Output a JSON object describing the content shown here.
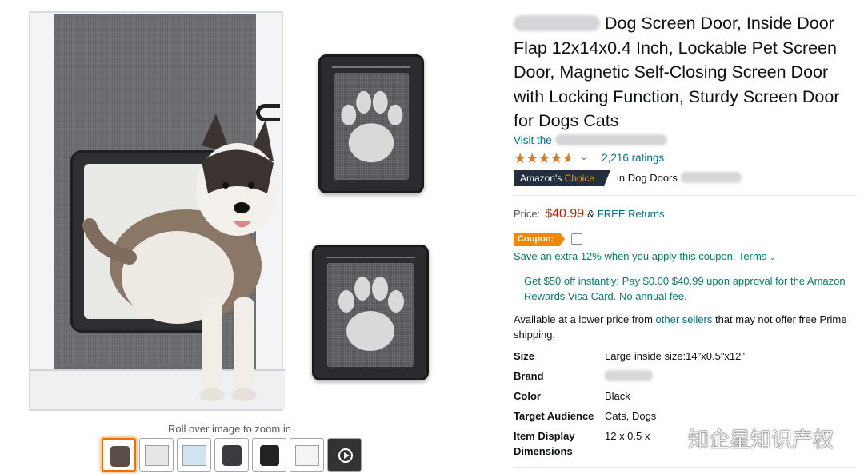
{
  "gallery": {
    "zoom_caption": "Roll over image to zoom in",
    "thumbnails": [
      {
        "kind": "main-dog",
        "active": true
      },
      {
        "kind": "door-dimensions"
      },
      {
        "kind": "installation"
      },
      {
        "kind": "door-detail"
      },
      {
        "kind": "door-dark"
      },
      {
        "kind": "instructions"
      },
      {
        "kind": "video"
      }
    ]
  },
  "product": {
    "title": "Dog Screen Door, Inside Door Flap 12x14x0.4 Inch, Lockable Pet Screen Door, Magnetic Self-Closing Screen Door with Locking Function, Sturdy Screen Door for Dogs Cats",
    "store_link": "Visit the",
    "rating": 4.5,
    "ratings_count": "2,216 ratings",
    "choice_badge_prefix": "Amazon's",
    "choice_badge_word": "Choice",
    "choice_category": "in Dog Doors",
    "price_label": "Price:",
    "price": "$40.99",
    "price_amp": "&",
    "free_returns": "FREE Returns",
    "coupon_label": "Coupon:",
    "coupon_text": "Save an extra 12% when you apply this coupon.",
    "coupon_terms": "Terms",
    "visa_offer_pre": "Get $50 off instantly: Pay $0.00",
    "visa_offer_strike": "$40.99",
    "visa_offer_post": "upon approval for the Amazon Rewards Visa Card. No annual fee.",
    "other_sellers_pre": "Available at a lower price from",
    "other_sellers_link": "other sellers",
    "other_sellers_post": "that may not offer free Prime shipping."
  },
  "specs": [
    {
      "key": "Size",
      "value": "Large inside size:14\"x0.5\"x12\""
    },
    {
      "key": "Brand",
      "value": ""
    },
    {
      "key": "Color",
      "value": "Black"
    },
    {
      "key": "Target Audience",
      "value": "Cats, Dogs"
    },
    {
      "key": "Item Display Dimensions",
      "value": "12 x 0.5 x"
    }
  ],
  "watermark": {
    "text": "知企星知识产权"
  },
  "colors": {
    "link": "#007185",
    "price": "#b12704",
    "deal_green": "#067d62",
    "star": "#de7921",
    "coupon": "#f08804",
    "choice_bg": "#232f3e"
  }
}
